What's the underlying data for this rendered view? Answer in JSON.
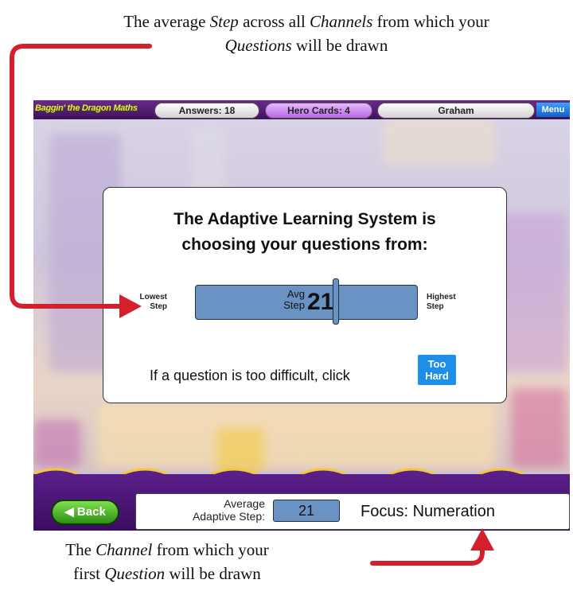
{
  "annotations": {
    "top": {
      "p1": "The average ",
      "e1": "Step",
      "p2": " across all ",
      "e2": "Channels",
      "p3": " from which your",
      "e3": "Questions",
      "p4": " will be drawn"
    },
    "bottom": {
      "p1": "The ",
      "e1": "Channel",
      "p2": " from which your",
      "p3": "first ",
      "e2": "Question",
      "p4": " will be drawn"
    }
  },
  "topbar": {
    "app_title": "Baggin' the Dragon Maths",
    "answers": "Answers: 18",
    "hero_cards": "Hero Cards: 4",
    "player_name": "Graham",
    "menu_label": "Menu"
  },
  "dialog": {
    "title_line1": "The Adaptive Learning System is",
    "title_line2": "choosing your questions from:",
    "lowest_line1": "Lowest",
    "lowest_line2": "Step",
    "highest_line1": "Highest",
    "highest_line2": "Step",
    "avg_line1": "Avg",
    "avg_line2": "Step",
    "avg_value": "21",
    "hint": "If a question is too difficult, click",
    "too_hard_line1": "Too",
    "too_hard_line2": "Hard"
  },
  "bottombar": {
    "back_label": "Back",
    "avg_label_line1": "Average",
    "avg_label_line2": "Adaptive Step:",
    "avg_value": "21",
    "focus": "Focus: Numeration"
  },
  "colors": {
    "arrow": "#d4202c",
    "bar": "#6a93c4",
    "purple": "#4a1670",
    "too_hard": "#1e8fe6"
  }
}
